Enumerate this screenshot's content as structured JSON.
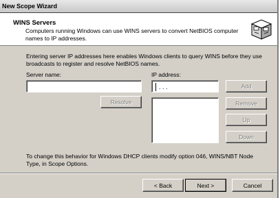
{
  "window": {
    "title": "New Scope Wizard"
  },
  "header": {
    "title": "WINS Servers",
    "subtitle": "Computers running Windows can use WINS servers to convert NetBIOS computer names to IP addresses."
  },
  "body": {
    "intro": "Entering server IP addresses here enables Windows clients to query WINS before they use broadcasts to register and resolve NetBIOS names.",
    "server_name_label": "Server name:",
    "server_name_value": "",
    "ip_address_label": "IP address:",
    "ip_address_value": ".   .   .",
    "footer_note": "To change this behavior for Windows DHCP clients modify option 046, WINS/NBT Node Type, in Scope Options."
  },
  "buttons": {
    "resolve": "Resolve",
    "add": "Add",
    "remove": "Remove",
    "up": "Up",
    "down": "Down",
    "back": "< Back",
    "next": "Next >",
    "cancel": "Cancel"
  },
  "icons": {
    "header_icon": "wizard-computers-icon"
  }
}
